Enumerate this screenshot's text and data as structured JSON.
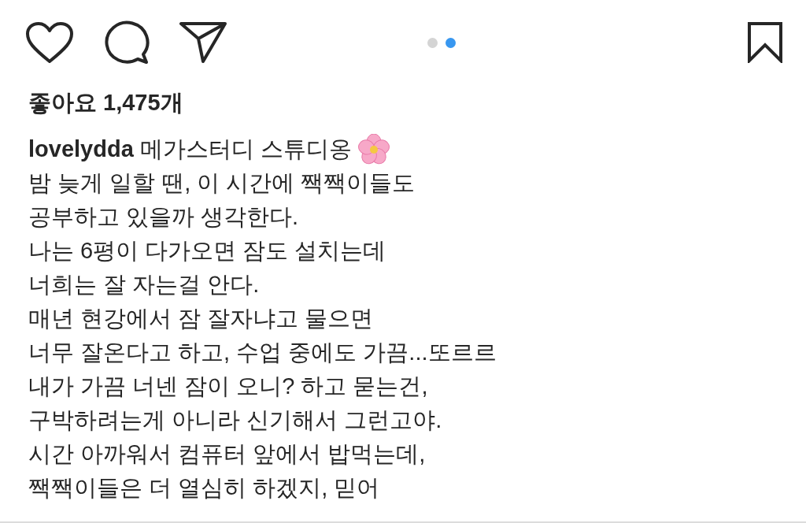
{
  "carousel_dots": [
    {
      "selected": false
    },
    {
      "selected": true
    }
  ],
  "likes": "좋아요 1,475개",
  "caption": {
    "username": "lovelydda",
    "first_line": "메가스터디 스튜디옹",
    "lines": [
      "밤 늦게 일할 땐, 이 시간에 짹짹이들도",
      "공부하고 있을까 생각한다.",
      "나는 6평이 다가오면 잠도 설치는데",
      "너희는 잘 자는걸 안다.",
      "매년 현강에서 잠 잘자냐고 물으면",
      "너무 잘온다고 하고, 수업 중에도 가끔...또르르",
      "내가 가끔 너넨 잠이 오니? 하고 묻는건,",
      "구박하려는게 아니라 신기해서 그런고야.",
      "시간 아까워서 컴퓨터 앞에서 밥먹는데,",
      "짹짹이들은 더 열심히 하겠지, 믿어"
    ]
  }
}
